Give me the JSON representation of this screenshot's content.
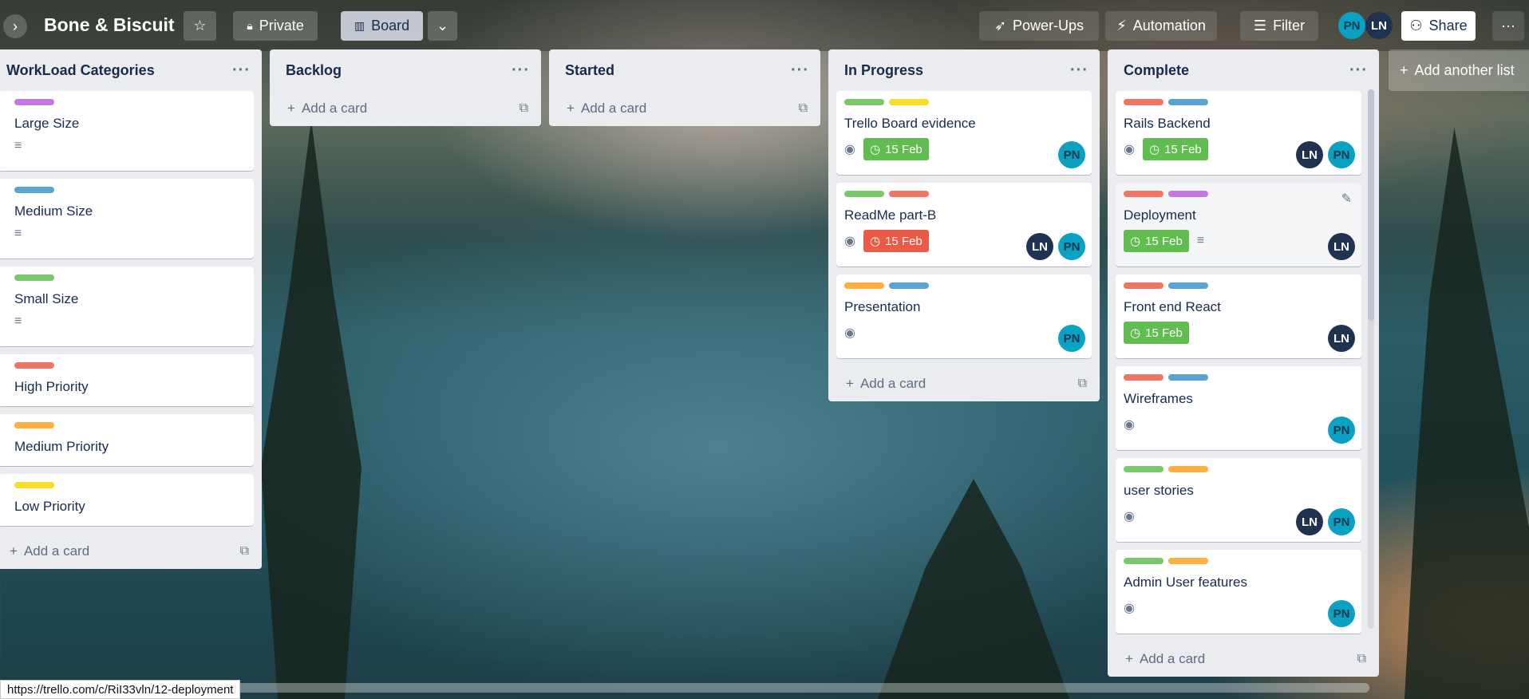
{
  "header": {
    "board_title": "Bone & Biscuit",
    "visibility": "Private",
    "view": "Board",
    "power_ups": "Power-Ups",
    "automation": "Automation",
    "filter": "Filter",
    "members": [
      "PN",
      "LN"
    ],
    "share": "Share"
  },
  "lists": [
    {
      "title": "WorkLoad Categories",
      "add_card": "Add a card",
      "cards": [
        {
          "title": "Large Size",
          "labels": [
            "#c377e0"
          ]
        },
        {
          "title": "Medium Size",
          "labels": [
            "#5ba4cf"
          ]
        },
        {
          "title": "Small Size",
          "labels": [
            "#7bc86c"
          ]
        },
        {
          "title": "High Priority",
          "labels": [
            "#ef7564"
          ]
        },
        {
          "title": "Medium Priority",
          "labels": [
            "#ffaf3f"
          ]
        },
        {
          "title": "Low Priority",
          "labels": [
            "#f5dd29"
          ]
        }
      ]
    },
    {
      "title": "Backlog",
      "add_card": "Add a card"
    },
    {
      "title": "Started",
      "add_card": "Add a card"
    },
    {
      "title": "In Progress",
      "add_card": "Add a card",
      "cards": [
        {
          "title": "Trello Board evidence",
          "date": "15 Feb",
          "date_status": "green",
          "members": [
            "PN"
          ],
          "labels": [
            "#7bc86c",
            "#f5dd29"
          ]
        },
        {
          "title": "ReadMe part-B",
          "date": "15 Feb",
          "date_status": "red",
          "members": [
            "LN",
            "PN"
          ],
          "labels": [
            "#7bc86c",
            "#ef7564"
          ]
        },
        {
          "title": "Presentation",
          "members": [
            "PN"
          ],
          "labels": [
            "#ffaf3f",
            "#5ba4cf"
          ]
        }
      ]
    },
    {
      "title": "Complete",
      "add_card": "Add a card",
      "cards": [
        {
          "title": "Rails Backend",
          "date": "15 Feb",
          "members": [
            "LN",
            "PN"
          ],
          "labels": [
            "#ef7564",
            "#5ba4cf"
          ]
        },
        {
          "title": "Deployment",
          "date": "15 Feb",
          "members": [
            "LN"
          ],
          "labels": [
            "#ef7564",
            "#c377e0"
          ]
        },
        {
          "title": "Front end React",
          "date": "15 Feb",
          "members": [
            "LN"
          ],
          "labels": [
            "#ef7564",
            "#5ba4cf"
          ]
        },
        {
          "title": "Wireframes",
          "members": [
            "PN"
          ],
          "labels": [
            "#ef7564",
            "#5ba4cf"
          ]
        },
        {
          "title": "user stories",
          "members": [
            "LN",
            "PN"
          ],
          "labels": [
            "#7bc86c",
            "#ffaf3f"
          ]
        },
        {
          "title": "Admin User features",
          "members": [
            "PN"
          ],
          "labels": [
            "#7bc86c",
            "#ffaf3f"
          ]
        }
      ]
    }
  ],
  "add_list": "Add another list",
  "status_url": "https://trello.com/c/RiI33vln/12-deployment"
}
